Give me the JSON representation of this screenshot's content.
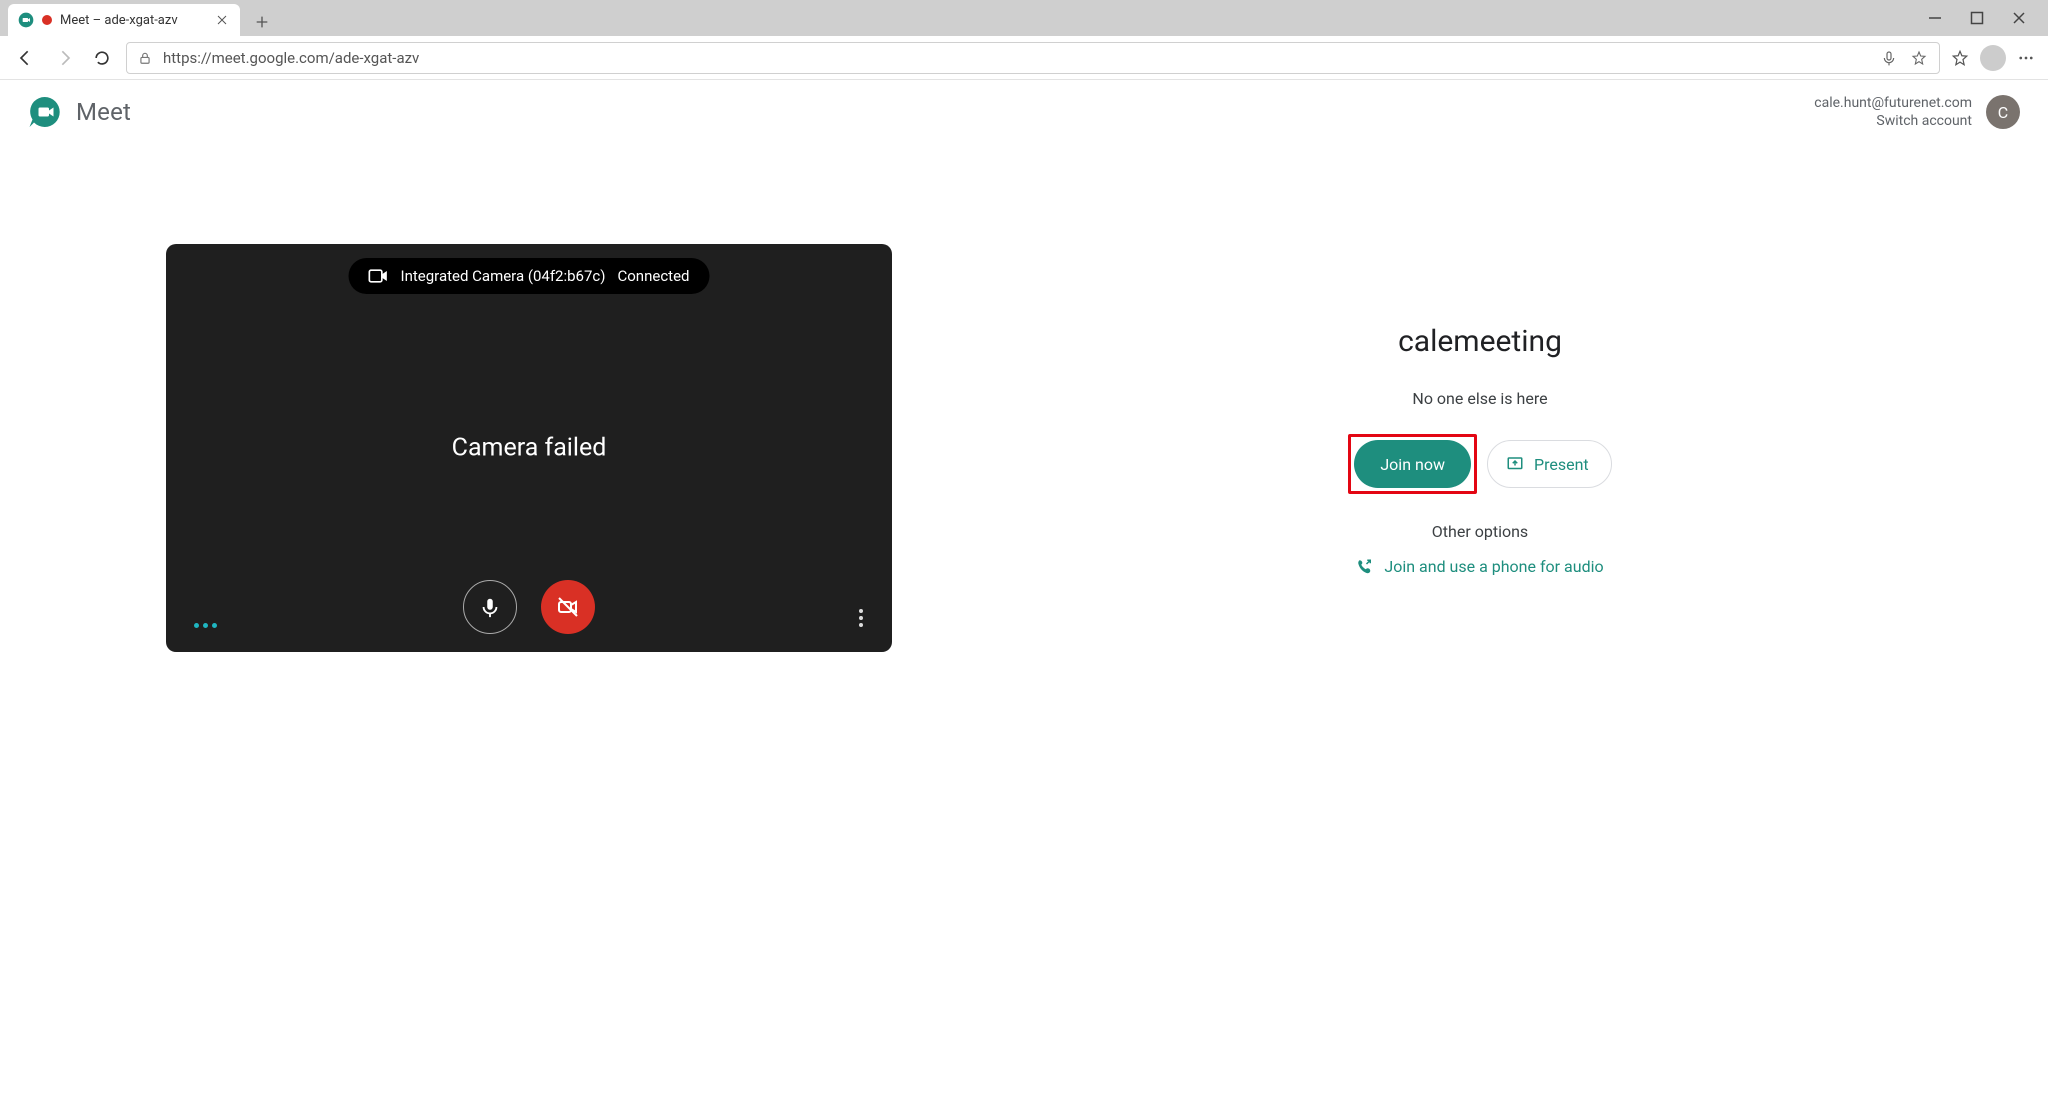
{
  "browser": {
    "tab_title": "Meet – ade-xgat-azv",
    "url": "https://meet.google.com/ade-xgat-azv"
  },
  "header": {
    "product_name": "Meet",
    "account_email": "cale.hunt@futurenet.com",
    "switch_account_label": "Switch account",
    "avatar_initial": "C"
  },
  "video": {
    "camera_device": "Integrated Camera (04f2:b67c)",
    "camera_status": "Connected",
    "error_message": "Camera failed"
  },
  "meeting": {
    "name": "calemeeting",
    "participants_note": "No one else is here",
    "join_label": "Join now",
    "present_label": "Present",
    "other_options_label": "Other options",
    "phone_audio_label": "Join and use a phone for audio"
  }
}
